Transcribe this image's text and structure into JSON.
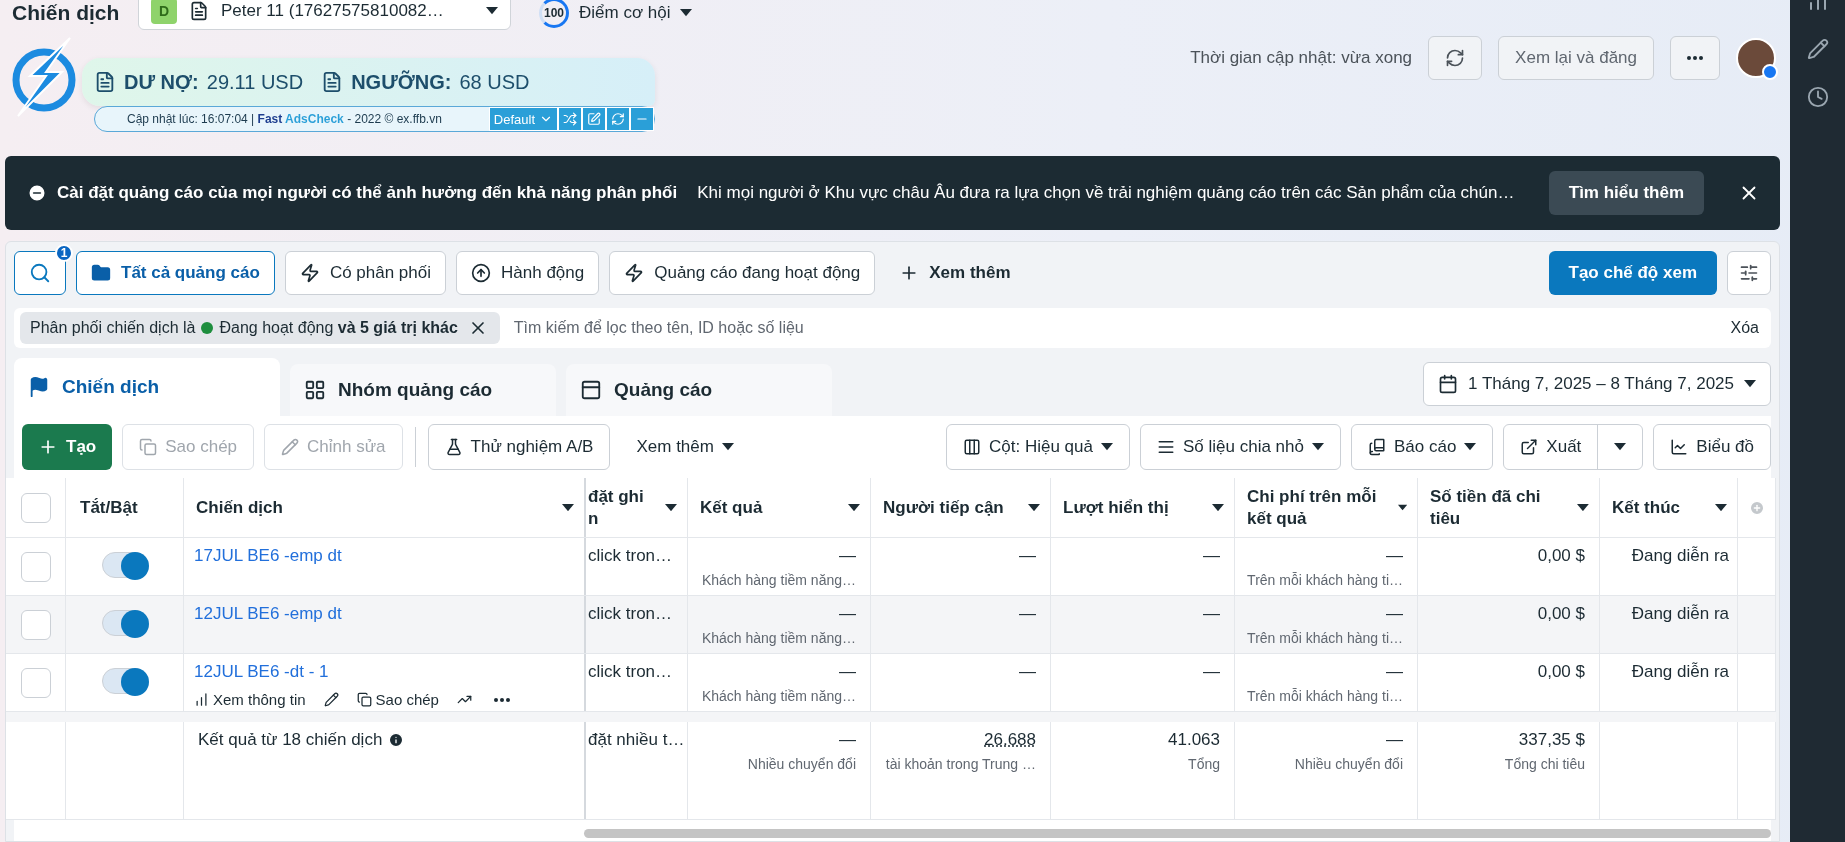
{
  "page_title": "Chiến dịch",
  "account": {
    "badge": "D",
    "name": "Peter 11 (17627575810082…"
  },
  "opportunity": {
    "score": "100",
    "label": "Điểm cơ hội"
  },
  "extension": {
    "debt_label": "DƯ NỢ:",
    "debt": "29.11 USD",
    "threshold_label": "NGƯỠNG:",
    "threshold": "68 USD",
    "updated": "Cập nhật lúc: 16:07:04 | **Fast AdsCheck** - 2022 © ex.ffb.vn",
    "profile": "Default"
  },
  "update_status": "Thời gian cập nhật: vừa xong",
  "review_button": "Xem lại và đăng",
  "banner": {
    "title": "Cài đặt quảng cáo của mọi người có thể ảnh hưởng đến khả năng phân phối",
    "text": "Khi mọi người ở Khu vực châu Âu đưa ra lựa chọn về trải nghiệm quảng cáo trên các Sản phẩm của chún…",
    "button": "Tìm hiểu thêm"
  },
  "search_badge": "1",
  "quick_filters": [
    {
      "label": "Tất cả quảng cáo",
      "kind": "folder",
      "selected": true
    },
    {
      "label": "Có phân phối",
      "kind": "bolt",
      "selected": false
    },
    {
      "label": "Hành động",
      "kind": "arrow",
      "selected": false
    },
    {
      "label": "Quảng cáo đang hoạt động",
      "kind": "bolt",
      "selected": false
    }
  ],
  "more_filters": "Xem thêm",
  "create_view": "Tạo chế độ xem",
  "filter_chip": {
    "prefix": "Phân phối chiến dịch là",
    "rest": "Đang hoạt động **và 5 giá trị khác**"
  },
  "search_placeholder": "Tìm kiếm để lọc theo tên, ID hoặc số liệu",
  "clear": "Xóa",
  "level_tabs": [
    {
      "label": "Chiến dịch",
      "kind": "campaign",
      "selected": true
    },
    {
      "label": "Nhóm quảng cáo",
      "kind": "adset",
      "selected": false
    },
    {
      "label": "Quảng cáo",
      "kind": "ad",
      "selected": false
    }
  ],
  "date_range": "1 Tháng 7, 2025 – 8 Tháng 7, 2025",
  "toolbar_left": [
    {
      "label": "Tạo",
      "kind": "create",
      "disabled": false
    },
    {
      "label": "Sao chép",
      "kind": "copy",
      "disabled": true
    },
    {
      "label": "Chỉnh sửa",
      "kind": "edit",
      "disabled": true
    },
    {
      "label": "Thử nghiệm A/B",
      "kind": "flask",
      "disabled": false
    },
    {
      "label": "Xem thêm",
      "kind": "more",
      "disabled": false
    }
  ],
  "toolbar_right": [
    {
      "label": "Cột: Hiệu quả",
      "kind": "columns"
    },
    {
      "label": "Số liệu chia nhỏ",
      "kind": "breakdown"
    },
    {
      "label": "Báo cáo",
      "kind": "report"
    },
    {
      "label": "Xuất",
      "kind": "export"
    },
    {
      "label": "Biểu đồ",
      "kind": "chart"
    }
  ],
  "table": {
    "select_all_checked": false,
    "toggle_header": "Tắt/Bật",
    "name_header": "Chiến dịch",
    "columns": [
      "đặt ghi\nn",
      "Kết quả",
      "Người tiếp cận",
      "Lượt hiển thị",
      "Chi phí trên mỗi kết quả",
      "Số tiền đã chi tiêu",
      "Kết thúc"
    ],
    "rows": [
      {
        "checked": false,
        "on": true,
        "name": "17JUL BE6 -emp dt",
        "cells": [
          {
            "value": "click tron…"
          },
          {
            "value": "—",
            "sub": "Khách hàng tiềm năng…"
          },
          {
            "value": "—"
          },
          {
            "value": "—"
          },
          {
            "value": "—",
            "sub": "Trên mỗi khách hàng ti…"
          },
          {
            "value": "0,00 $"
          },
          {
            "value": "Đang diễn ra"
          }
        ]
      },
      {
        "checked": false,
        "on": true,
        "name": "12JUL BE6 -emp dt",
        "cells": [
          {
            "value": "click tron…"
          },
          {
            "value": "—",
            "sub": "Khách hàng tiềm năng…"
          },
          {
            "value": "—"
          },
          {
            "value": "—"
          },
          {
            "value": "—",
            "sub": "Trên mỗi khách hàng ti…"
          },
          {
            "value": "0,00 $"
          },
          {
            "value": "Đang diễn ra"
          }
        ]
      },
      {
        "checked": false,
        "on": true,
        "name": "12JUL BE6 -dt - 1",
        "actions": {
          "view": "Xem thông tin",
          "copy": "Sao chép"
        },
        "cells": [
          {
            "value": "click tron…"
          },
          {
            "value": "—",
            "sub": "Khách hàng tiềm năng…"
          },
          {
            "value": "—"
          },
          {
            "value": "—"
          },
          {
            "value": "—",
            "sub": "Trên mỗi khách hàng ti…"
          },
          {
            "value": "0,00 $"
          },
          {
            "value": "Đang diễn ra"
          }
        ]
      }
    ],
    "footer": {
      "label": "Kết quả từ 18 chiến dịch",
      "cells": [
        {
          "value": "đặt nhiều t…"
        },
        {
          "value": "—",
          "sub": "Nhiều chuyển đổi"
        },
        {
          "value": "26.688",
          "sub": "tài khoản trong Trung …"
        },
        {
          "value": "41.063",
          "sub": "Tổng"
        },
        {
          "value": "—",
          "sub": "Nhiều chuyển đổi"
        },
        {
          "value": "337,35 $",
          "sub": "Tổng chi tiêu"
        }
      ]
    }
  }
}
